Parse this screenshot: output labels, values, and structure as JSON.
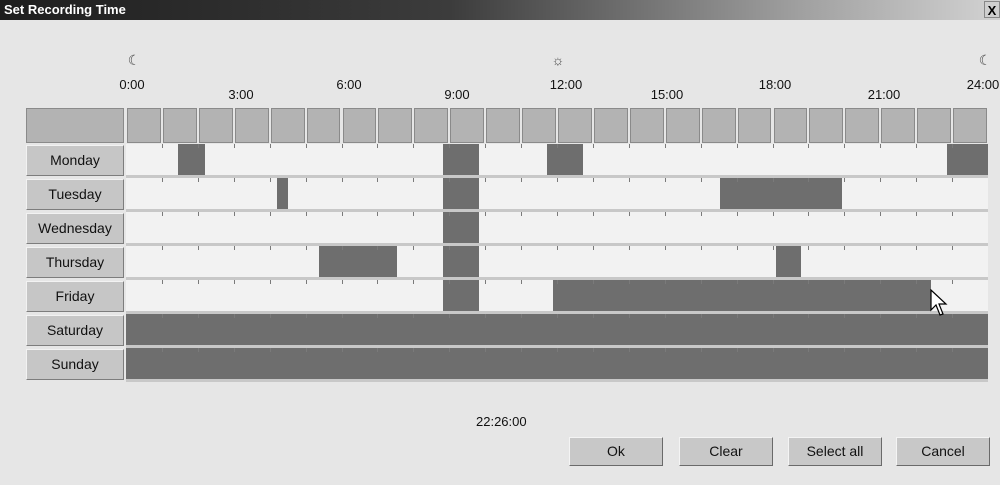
{
  "window": {
    "title": "Set Recording Time",
    "close_label": "X"
  },
  "time_labels": [
    "0:00",
    "3:00",
    "6:00",
    "9:00",
    "12:00",
    "15:00",
    "18:00",
    "21:00",
    "24:00"
  ],
  "time_icons": [
    {
      "name": "moon-icon",
      "glyph": "☾"
    },
    {
      "name": "sun-icon",
      "glyph": "☼"
    },
    {
      "name": "moon-icon",
      "glyph": "☾"
    }
  ],
  "days": [
    {
      "label": "Monday",
      "blocks": [
        [
          4.35,
          6.6
        ],
        [
          26.5,
          29.5
        ],
        [
          35.2,
          38.2
        ],
        [
          68.6,
          72
        ]
      ]
    },
    {
      "label": "Tuesday",
      "blocks": [
        [
          12.6,
          13.5
        ],
        [
          26.5,
          29.5
        ],
        [
          49.6,
          59.8
        ]
      ]
    },
    {
      "label": "Wednesday",
      "blocks": [
        [
          26.5,
          29.5
        ]
      ]
    },
    {
      "label": "Thursday",
      "blocks": [
        [
          16.1,
          22.6
        ],
        [
          26.5,
          29.5
        ],
        [
          54.3,
          56.4
        ]
      ]
    },
    {
      "label": "Friday",
      "blocks": [
        [
          26.5,
          29.5
        ],
        [
          35.7,
          67.2
        ]
      ]
    },
    {
      "label": "Saturday",
      "blocks": [
        [
          0,
          72
        ]
      ]
    },
    {
      "label": "Sunday",
      "blocks": [
        [
          0,
          72
        ]
      ]
    }
  ],
  "clock_text": "22:26:00",
  "buttons": {
    "ok": "Ok",
    "clear": "Clear",
    "select_all": "Select all",
    "cancel": "Cancel"
  }
}
